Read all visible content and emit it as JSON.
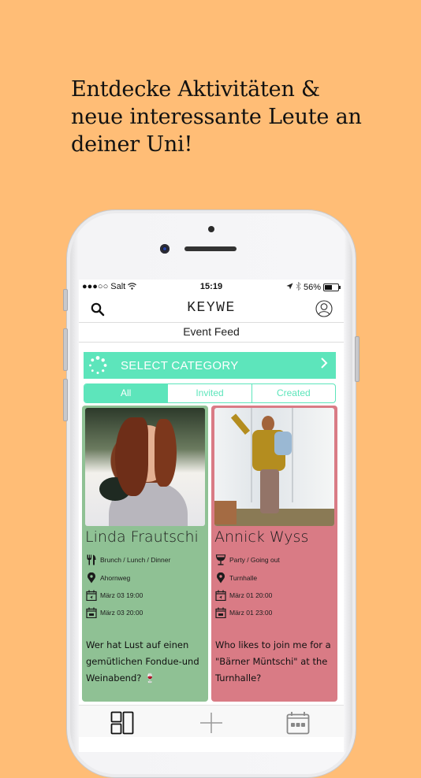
{
  "headline": "Entdecke Aktivitäten & neue interessante Leute an deiner Uni!",
  "status_bar": {
    "carrier": "●●●○○ Salt",
    "time": "15:19",
    "battery": "56%",
    "battery_level": 0.56
  },
  "nav": {
    "title": "KEYWE",
    "search_icon": "search-icon",
    "profile_icon": "profile-icon"
  },
  "feed_title": "Event Feed",
  "category": {
    "label": "SELECT CATEGORY",
    "accent": "#5DE5BB"
  },
  "segments": [
    {
      "label": "All",
      "active": true
    },
    {
      "label": "Invited",
      "active": false
    },
    {
      "label": "Created",
      "active": false
    }
  ],
  "events": [
    {
      "name": "Linda Frautschi",
      "category": "Brunch / Lunch / Dinner",
      "category_icon": "cutlery-icon",
      "location": "Ahornweg",
      "start": "März 03 19:00",
      "end": "März 03 20:00",
      "description": "Wer hat Lust auf einen gemütlichen Fondue-und Weinabend? 🍷",
      "color": "#8FC194"
    },
    {
      "name": "Annick Wyss",
      "category": "Party / Going out",
      "category_icon": "wine-glass-icon",
      "location": "Turnhalle",
      "start": "März 01 20:00",
      "end": "März 01 23:00",
      "description": "Who likes to join me for a \"Bärner Müntschi\" at the Turnhalle?",
      "color": "#D97B85"
    }
  ],
  "tabbar": {
    "items": [
      "feed-icon",
      "add-icon",
      "calendar-icon"
    ]
  }
}
